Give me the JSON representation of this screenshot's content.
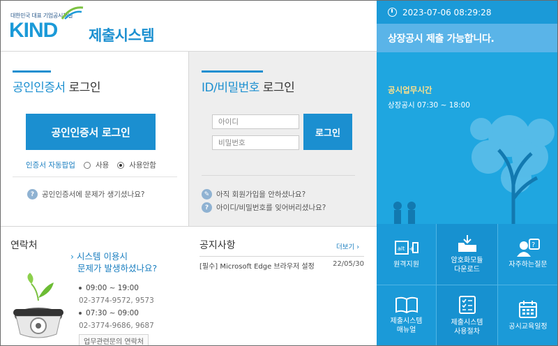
{
  "header": {
    "tagline": "대한민국 대표 기업공시채널",
    "logo": "KIND",
    "system_title": "제출시스템"
  },
  "cert_login": {
    "title_highlight": "공인인증서",
    "title_rest": " 로그인",
    "button": "공인인증서 로그인",
    "auto_popup_label": "인증서 자동팝업",
    "option_use": "사용",
    "option_no_use": "사용안함",
    "selected_option": "사용안함",
    "help": "공인인증서에 문제가 생기셨나요?"
  },
  "id_login": {
    "title_highlight": "ID/비밀번호",
    "title_rest": " 로그인",
    "id_placeholder": "아이디",
    "pw_placeholder": "비밀번호",
    "button": "로그인",
    "help_join": "아직 회원가입을 안하셨나요?",
    "help_forgot": "아이디/비밀번호를 잊어버리셨나요?"
  },
  "status": {
    "datetime": "2023-07-06  08:29:28",
    "banner": "상장공시 제출 가능합니다.",
    "hours_title": "공시업무시간",
    "hours_text": "상장공시 07:30 ~ 18:00"
  },
  "contact": {
    "title": "연락처",
    "question_line1": "시스템 이용시",
    "question_line2": "문제가 발생하셨나요?",
    "time1": "09:00 ~ 19:00",
    "phone1": "02-3774-9572, 9573",
    "time2": "07:30 ~ 09:00",
    "phone2": "02-3774-9686, 9687",
    "note": "업무관련문의 연락처"
  },
  "notice": {
    "title": "공지사항",
    "more": "더보기",
    "items": [
      {
        "title": "[필수] Microsoft Edge 브라우저 설정",
        "date": "22/05/30"
      }
    ]
  },
  "tiles": [
    {
      "label": "원격지원",
      "icon": "remote-support-icon"
    },
    {
      "label": "암호화모듈\n다운로드",
      "icon": "download-folder-icon"
    },
    {
      "label": "자주하는질문",
      "icon": "faq-icon"
    },
    {
      "label": "제출시스템\n매뉴얼",
      "icon": "manual-book-icon"
    },
    {
      "label": "제출시스템\n사용절차",
      "icon": "checklist-icon"
    },
    {
      "label": "공시교육일정",
      "icon": "calendar-icon"
    }
  ],
  "colors": {
    "primary": "#1b8fd0",
    "banner": "#5ab4e8",
    "panel_blue": "#1fa6e0",
    "tile_blue": "#1b9ad8",
    "hours_title": "#ffe08a"
  }
}
